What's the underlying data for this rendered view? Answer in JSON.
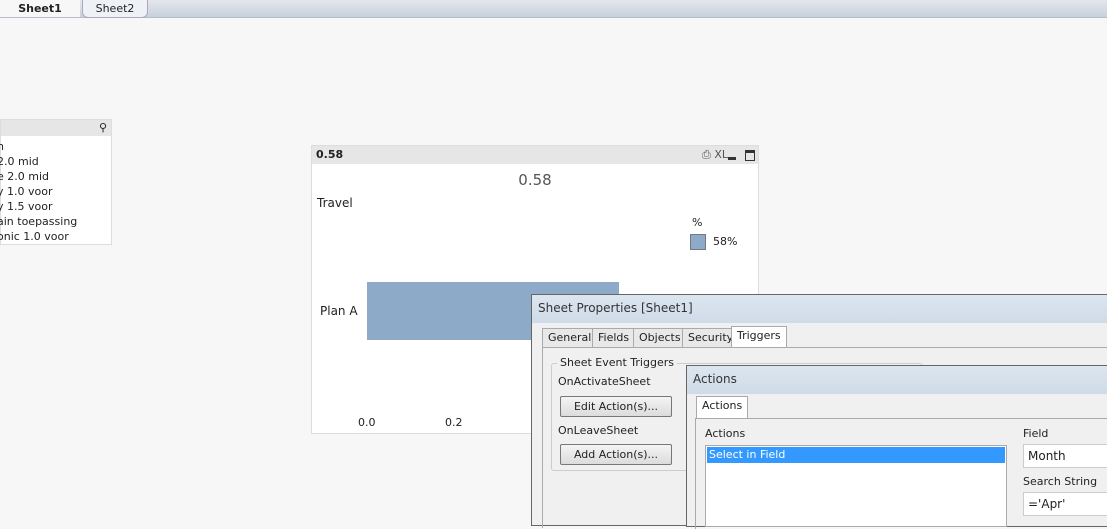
{
  "sheet_tabs": [
    "Sheet1",
    "Sheet2"
  ],
  "listbox": {
    "items": [
      "h",
      "2.0 mid",
      "e 2.0 mid",
      "y 1.0 voor",
      "y 1.5 voor",
      "ain toepassing",
      "onic 1.0 voor"
    ]
  },
  "chart": {
    "caption": "0.58",
    "icons": [
      "print-icon",
      "xl-export-icon",
      "minimize-icon",
      "maximize-icon"
    ],
    "xl_label": "XL"
  },
  "chart_data": {
    "type": "bar",
    "orientation": "horizontal",
    "title": "0.58",
    "ylabel": "Travel",
    "categories": [
      "Plan A"
    ],
    "series": [
      {
        "name": "%",
        "values": [
          0.58
        ]
      }
    ],
    "legend": {
      "title": "%",
      "entries": [
        "58%"
      ],
      "position": "top-right"
    },
    "xticks": [
      "0.0",
      "0.2"
    ],
    "color": "#8eaac9"
  },
  "sheet_props": {
    "title": "Sheet Properties [Sheet1]",
    "tabs": [
      "General",
      "Fields",
      "Objects",
      "Security",
      "Triggers"
    ],
    "group": "Sheet Event Triggers",
    "on_activate": "OnActivateSheet",
    "edit_btn": "Edit Action(s)...",
    "on_leave": "OnLeaveSheet",
    "add_btn": "Add Action(s)..."
  },
  "actions": {
    "title": "Actions",
    "tab": "Actions",
    "list_label": "Actions",
    "items": [
      "Select in Field"
    ],
    "field_label": "Field",
    "field_value": "Month",
    "search_label": "Search String",
    "search_value": "='Apr'"
  }
}
